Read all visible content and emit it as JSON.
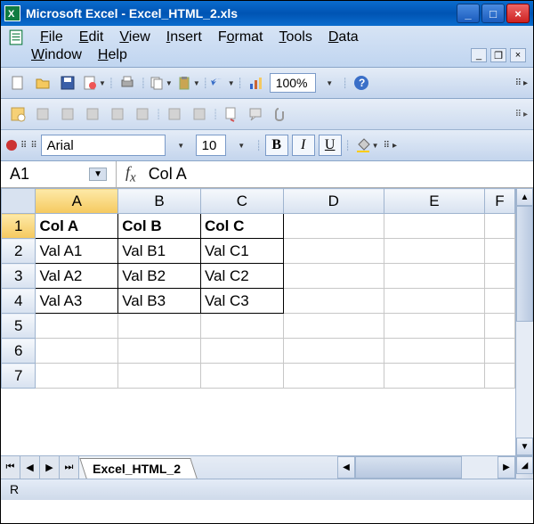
{
  "title": "Microsoft Excel - Excel_HTML_2.xls",
  "menus": {
    "file": "File",
    "edit": "Edit",
    "view": "View",
    "insert": "Insert",
    "format": "Format",
    "tools": "Tools",
    "data": "Data",
    "window": "Window",
    "help": "Help"
  },
  "toolbar": {
    "zoom": "100%"
  },
  "formatting": {
    "font_name": "Arial",
    "font_size": "10",
    "bold": "B",
    "italic": "I",
    "underline": "U"
  },
  "namebox": "A1",
  "formula_value": "Col A",
  "columns": [
    "A",
    "B",
    "C",
    "D",
    "E",
    "F"
  ],
  "rows": [
    "1",
    "2",
    "3",
    "4",
    "5",
    "6",
    "7"
  ],
  "cells": {
    "r1": {
      "c1": "Col A",
      "c2": "Col B",
      "c3": "Col C"
    },
    "r2": {
      "c1": "Val A1",
      "c2": "Val B1",
      "c3": "Val C1"
    },
    "r3": {
      "c1": "Val A2",
      "c2": "Val B2",
      "c3": "Val C2"
    },
    "r4": {
      "c1": "Val A3",
      "c2": "Val B3",
      "c3": "Val C3"
    }
  },
  "sheet_tab": "Excel_HTML_2",
  "status": "R"
}
